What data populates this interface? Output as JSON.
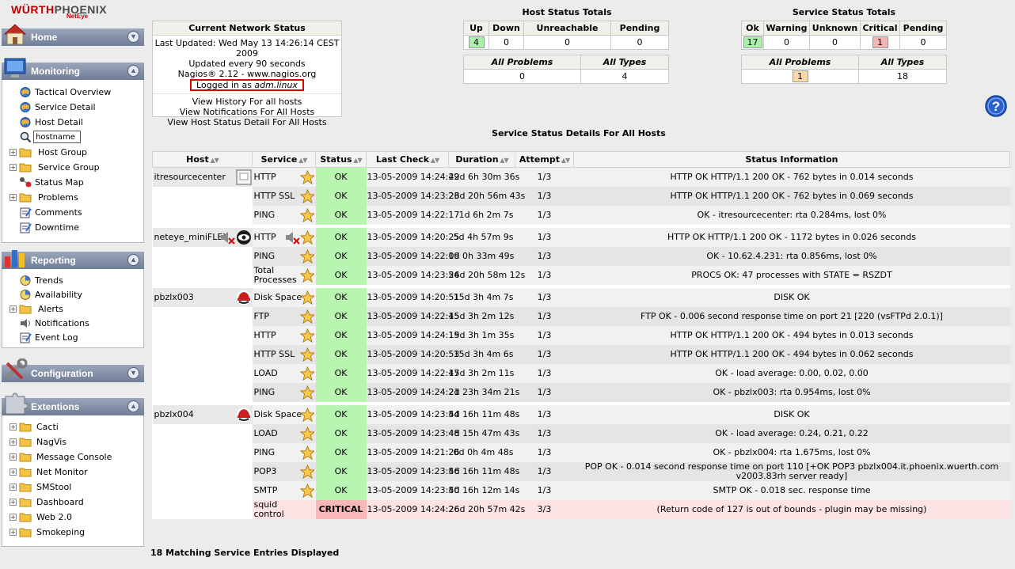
{
  "logo": {
    "brand_red": "WÜRTH",
    "brand_grey": "PHOENIX",
    "sub": "NetEye"
  },
  "sidebar": {
    "home": {
      "title": "Home"
    },
    "monitoring": {
      "title": "Monitoring",
      "items": [
        "Tactical Overview",
        "Service Detail",
        "Host Detail"
      ],
      "search_value": "hostname",
      "expandable": [
        "Host Group",
        "Service Group"
      ],
      "items2": [
        "Status Map"
      ],
      "expandable2": [
        "Problems"
      ],
      "items3": [
        "Comments",
        "Downtime"
      ]
    },
    "reporting": {
      "title": "Reporting",
      "items": [
        "Trends",
        "Availability"
      ],
      "expandable": [
        "Alerts"
      ],
      "items2": [
        "Notifications",
        "Event Log"
      ]
    },
    "configuration": {
      "title": "Configuration"
    },
    "extentions": {
      "title": "Extentions",
      "items": [
        "Cacti",
        "NagVis",
        "Message Console",
        "Net Monitor",
        "SMStool",
        "Dashboard",
        "Web 2.0",
        "Smokeping"
      ]
    }
  },
  "network_status": {
    "title": "Current Network Status",
    "last_updated": "Last Updated: Wed May 13 14:26:14 CEST 2009",
    "update_freq": "Updated every 90 seconds",
    "version": "Nagios® 2.12 - www.nagios.org",
    "logged_in_prefix": "Logged in as ",
    "logged_in_user": "adm.linux",
    "links": [
      "View History For all hosts",
      "View Notifications For All Hosts",
      "View Host Status Detail For All Hosts"
    ]
  },
  "host_totals": {
    "title": "Host Status Totals",
    "headers": [
      "Up",
      "Down",
      "Unreachable",
      "Pending"
    ],
    "values": [
      "4",
      "0",
      "0",
      "0"
    ],
    "headers2": [
      "All Problems",
      "All Types"
    ],
    "values2": [
      "0",
      "4"
    ]
  },
  "service_totals": {
    "title": "Service Status Totals",
    "headers": [
      "Ok",
      "Warning",
      "Unknown",
      "Critical",
      "Pending"
    ],
    "values": [
      "17",
      "0",
      "0",
      "1",
      "0"
    ],
    "headers2": [
      "All Problems",
      "All Types"
    ],
    "values2": [
      "1",
      "18"
    ]
  },
  "details": {
    "title": "Service Status Details For All Hosts",
    "columns": [
      "Host",
      "Service",
      "Status",
      "Last Check",
      "Duration",
      "Attempt",
      "Status Information"
    ],
    "rows": [
      {
        "host": "itresourcecenter",
        "service": "HTTP",
        "status": "OK",
        "last_check": "13-05-2009 14:24:49",
        "duration": "22d 6h 30m 36s",
        "attempt": "1/3",
        "info": "HTTP OK HTTP/1.1 200 OK - 762 bytes in 0.014 seconds"
      },
      {
        "host": "",
        "service": "HTTP SSL",
        "status": "OK",
        "last_check": "13-05-2009 14:23:23",
        "duration": "26d 20h 56m 43s",
        "attempt": "1/3",
        "info": "HTTP OK HTTP/1.1 200 OK - 762 bytes in 0.069 seconds"
      },
      {
        "host": "",
        "service": "PING",
        "status": "OK",
        "last_check": "13-05-2009 14:22:17",
        "duration": "1d 6h 2m 7s",
        "attempt": "1/3",
        "info": "OK - itresourcecenter: rta 0.284ms, lost 0%"
      },
      {
        "host": "neteye_miniFLEX",
        "service": "HTTP",
        "status": "OK",
        "last_check": "13-05-2009 14:20:25",
        "duration": "5d 4h 57m 9s",
        "attempt": "1/3",
        "info": "HTTP OK HTTP/1.1 200 OK - 1172 bytes in 0.026 seconds"
      },
      {
        "host": "",
        "service": "PING",
        "status": "OK",
        "last_check": "13-05-2009 14:22:19",
        "duration": "0d 0h 33m 49s",
        "attempt": "1/3",
        "info": "OK - 10.62.4.231: rta 0.856ms, lost 0%"
      },
      {
        "host": "",
        "service": "Total Processes",
        "status": "OK",
        "last_check": "13-05-2009 14:23:54",
        "duration": "26d 20h 58m 12s",
        "attempt": "1/3",
        "info": "PROCS OK: 47 processes with STATE = RSZDT"
      },
      {
        "host": "pbzlx003",
        "service": "Disk Space",
        "status": "OK",
        "last_check": "13-05-2009 14:20:51",
        "duration": "15d 3h 4m 7s",
        "attempt": "1/3",
        "info": "DISK OK"
      },
      {
        "host": "",
        "service": "FTP",
        "status": "OK",
        "last_check": "13-05-2009 14:22:45",
        "duration": "15d 3h 2m 12s",
        "attempt": "1/3",
        "info": "FTP OK - 0.006 second response time on port 21 [220 (vsFTPd 2.0.1)]"
      },
      {
        "host": "",
        "service": "HTTP",
        "status": "OK",
        "last_check": "13-05-2009 14:24:19",
        "duration": "15d 3h 1m 35s",
        "attempt": "1/3",
        "info": "HTTP OK HTTP/1.1 200 OK - 494 bytes in 0.013 seconds"
      },
      {
        "host": "",
        "service": "HTTP SSL",
        "status": "OK",
        "last_check": "13-05-2009 14:20:53",
        "duration": "15d 3h 4m 6s",
        "attempt": "1/3",
        "info": "HTTP OK HTTP/1.1 200 OK - 494 bytes in 0.062 seconds"
      },
      {
        "host": "",
        "service": "LOAD",
        "status": "OK",
        "last_check": "13-05-2009 14:22:47",
        "duration": "15d 3h 2m 11s",
        "attempt": "1/3",
        "info": "OK - load average: 0.00, 0.02, 0.00"
      },
      {
        "host": "",
        "service": "PING",
        "status": "OK",
        "last_check": "13-05-2009 14:24:21",
        "duration": "2d 23h 34m 21s",
        "attempt": "1/3",
        "info": "OK - pbzlx003: rta 0.954ms, lost 0%"
      },
      {
        "host": "pbzlx004",
        "service": "Disk Space",
        "status": "OK",
        "last_check": "13-05-2009 14:23:54",
        "duration": "4d 16h 11m 48s",
        "attempt": "1/3",
        "info": "DISK OK"
      },
      {
        "host": "",
        "service": "LOAD",
        "status": "OK",
        "last_check": "13-05-2009 14:23:48",
        "duration": "4d 15h 47m 43s",
        "attempt": "1/3",
        "info": "OK - load average: 0.24, 0.21, 0.22"
      },
      {
        "host": "",
        "service": "PING",
        "status": "OK",
        "last_check": "13-05-2009 14:21:26",
        "duration": "0d 0h 4m 48s",
        "attempt": "1/3",
        "info": "OK - pbzlx004: rta 1.675ms, lost 0%"
      },
      {
        "host": "",
        "service": "POP3",
        "status": "OK",
        "last_check": "13-05-2009 14:23:56",
        "duration": "4d 16h 11m 48s",
        "attempt": "1/3",
        "info": "POP OK - 0.014 second response time on port 110 [+OK POP3 pbzlx004.it.phoenix.wuerth.com v2003.83rh server ready]"
      },
      {
        "host": "",
        "service": "SMTP",
        "status": "OK",
        "last_check": "13-05-2009 14:23:50",
        "duration": "4d 16h 12m 14s",
        "attempt": "1/3",
        "info": "SMTP OK - 0.018 sec. response time"
      },
      {
        "host": "",
        "service": "squid control",
        "status": "CRITICAL",
        "last_check": "13-05-2009 14:24:26",
        "duration": "26d 20h 57m 42s",
        "attempt": "3/3",
        "info": "(Return code of 127 is out of bounds - plugin may be missing)"
      }
    ]
  },
  "footer": "18 Matching Service Entries Displayed",
  "colors": {
    "ok": "#b8f5b0",
    "critical": "#f8b8b8",
    "sidebar_header": "#7d8aa2",
    "brand": "#c00000"
  }
}
